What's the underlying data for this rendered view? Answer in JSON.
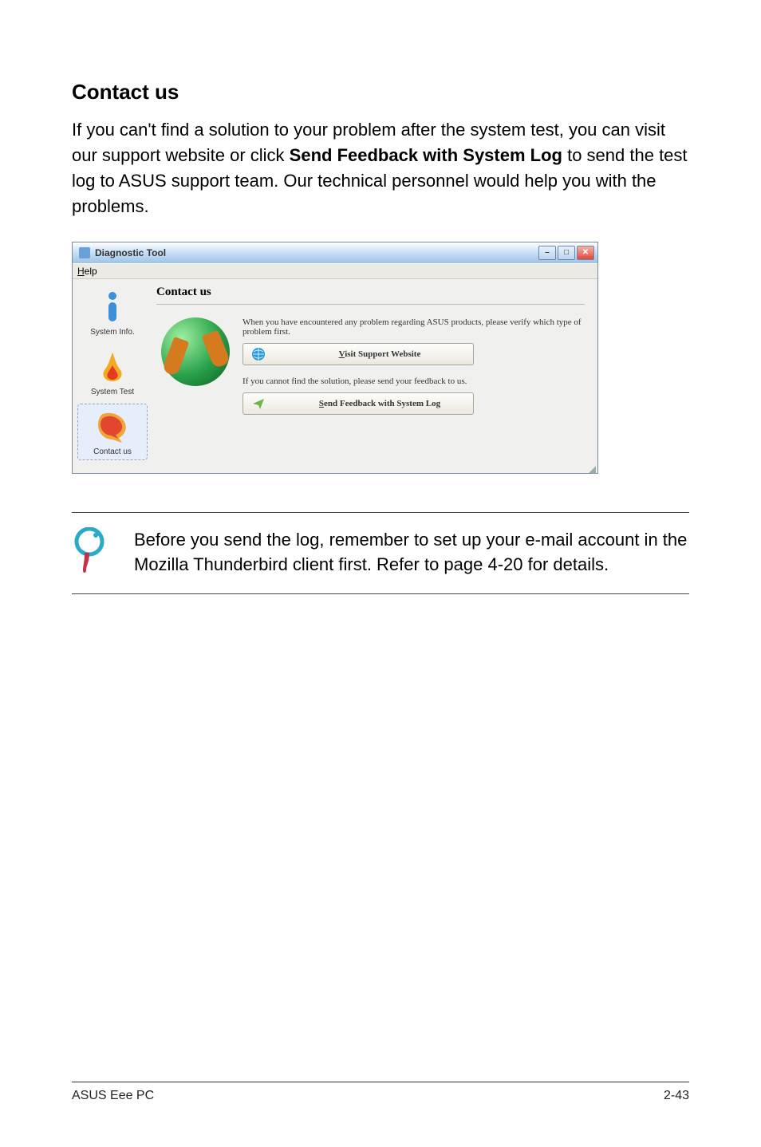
{
  "heading": "Contact us",
  "paragraph_parts": {
    "p1": "If you can't find a solution to your problem after the system test, you can visit our support website or click ",
    "bold": "Send Feedback with System Log",
    "p2": " to send the test log to ASUS support team. Our technical personnel would help you with the problems."
  },
  "window": {
    "title": "Diagnostic Tool",
    "menu_help": "Help",
    "sidebar": {
      "info": "System Info.",
      "test": "System Test",
      "contact": "Contact us"
    },
    "content": {
      "heading": "Contact us",
      "line1": "When you have encountered any problem regarding ASUS products, please verify which type of problem first.",
      "btn1": "Visit Support Website",
      "btn1_u": "V",
      "line2": "If you cannot find the solution, please send your feedback to us.",
      "btn2": "Send Feedback with System Log",
      "btn2_u": "S"
    }
  },
  "note": "Before you send the log, remember to set up your e-mail account in the Mozilla Thunderbird client first. Refer to page 4-20 for details.",
  "footer": {
    "left": "ASUS Eee PC",
    "right": "2-43"
  }
}
